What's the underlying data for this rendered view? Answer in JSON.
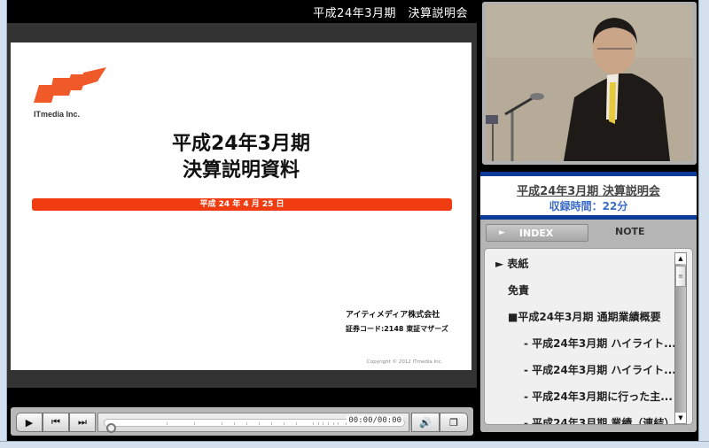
{
  "player": {
    "title": "平成24年3月期　決算説明会",
    "slide": {
      "logo_text": "ITmedia Inc.",
      "title_line1": "平成24年3月期",
      "title_line2": "決算説明資料",
      "date": "平成 24 年 4 月 25 日",
      "company": "アイティメディア株式会社",
      "stock_code": "証券コード:2148 東証マザーズ",
      "copyright": "Copyright © 2012 ITmedia Inc.",
      "accent_color": "#f03c10"
    },
    "controls": {
      "play_icon": "▶",
      "prev_icon": "⏮",
      "next_icon": "⏭",
      "volume_icon": "🔊",
      "popout_icon": "❐",
      "time": "00:00/00:00",
      "progress": 0
    }
  },
  "sidebar": {
    "session_title": "平成24年3月期 決算説明会",
    "duration": "収録時間：22分",
    "tabs": {
      "index": "INDEX",
      "index_arrow": "►",
      "note": "NOTE"
    },
    "index_items": [
      {
        "label": "► 表紙"
      },
      {
        "label": "免責"
      },
      {
        "label": "■平成24年3月期 通期業績概要"
      },
      {
        "label": "- 平成24年3月期 ハイライト..."
      },
      {
        "label": "- 平成24年3月期 ハイライト..."
      },
      {
        "label": "- 平成24年3月期に行った主..."
      },
      {
        "label": "- 平成24年3月期 業績（連結）"
      }
    ],
    "scroll": {
      "up": "▲",
      "down": "▼",
      "thumb": "≡"
    }
  },
  "colors": {
    "header_blue": "#0b3c9a",
    "duration_blue": "#3b6cc8"
  }
}
